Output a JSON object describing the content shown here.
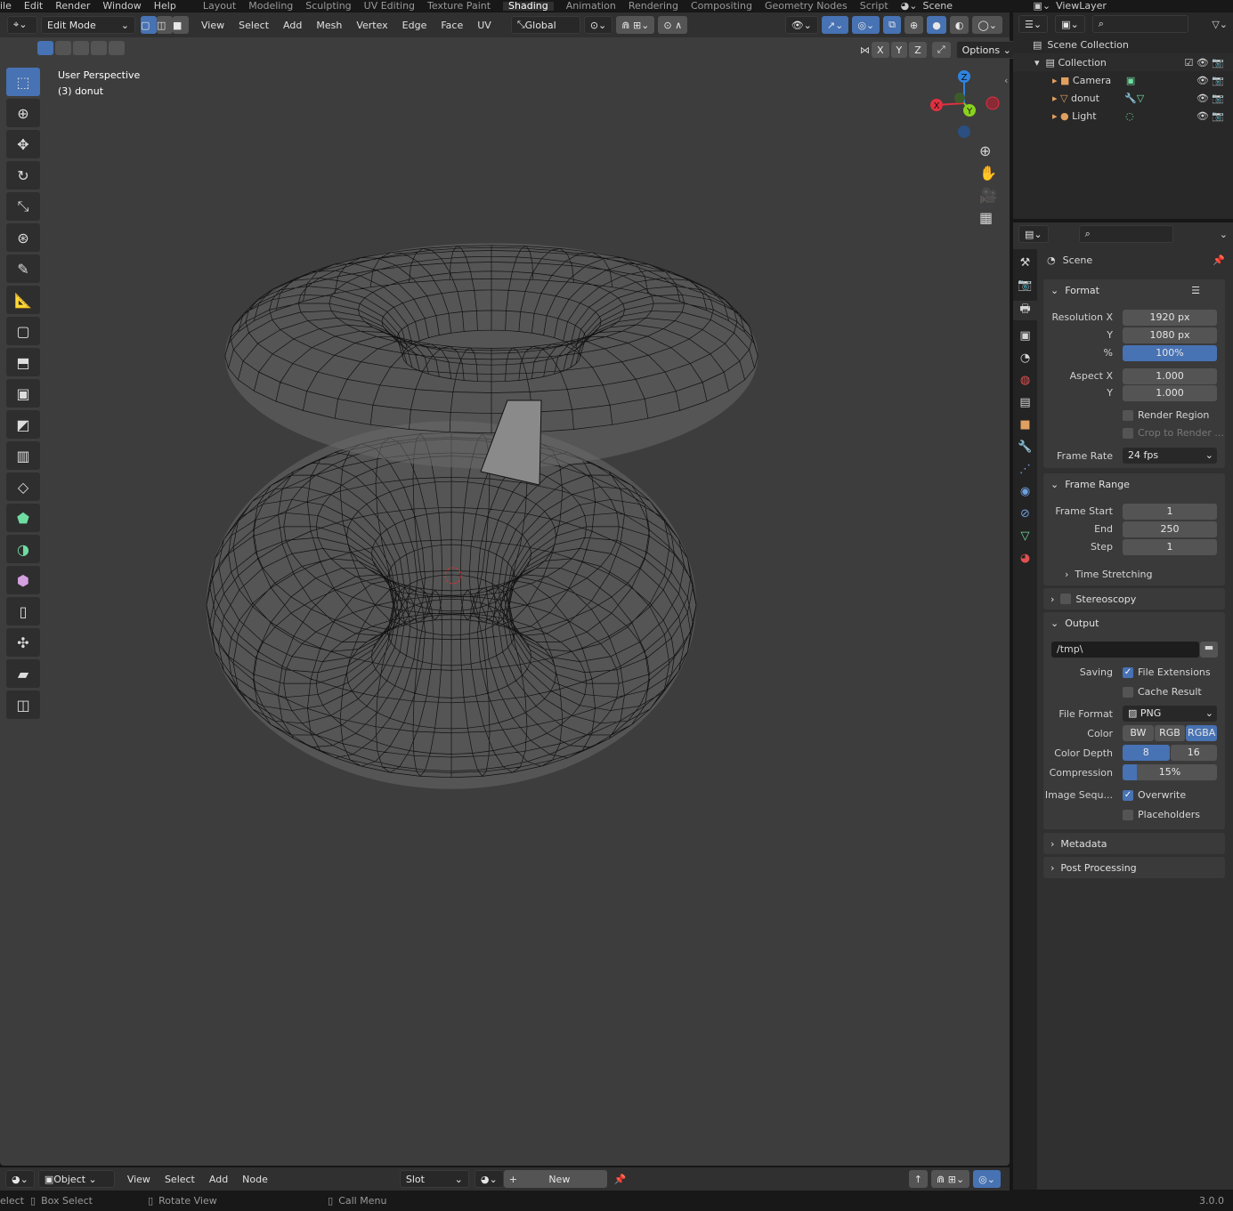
{
  "topbar": {
    "menus": [
      "ile",
      "Edit",
      "Render",
      "Window",
      "Help"
    ],
    "workspaces": [
      "Layout",
      "Modeling",
      "Sculpting",
      "UV Editing",
      "Texture Paint",
      "Shading",
      "Animation",
      "Rendering",
      "Compositing",
      "Geometry Nodes",
      "Script"
    ],
    "active_workspace": "Shading",
    "scene": "Scene",
    "view_layer": "ViewLayer"
  },
  "viewport": {
    "mode": "Edit Mode",
    "menus": [
      "View",
      "Select",
      "Add",
      "Mesh",
      "Vertex",
      "Edge",
      "Face",
      "UV"
    ],
    "orientation": "Global",
    "axes": [
      "X",
      "Y",
      "Z"
    ],
    "options": "Options",
    "overlay_title": "User Perspective",
    "overlay_object": "(3) donut",
    "gizmo": {
      "x": "X",
      "y": "Y",
      "z": "Z"
    }
  },
  "outliner": {
    "root": "Scene Collection",
    "collection": "Collection",
    "items": [
      "Camera",
      "donut",
      "Light"
    ]
  },
  "properties": {
    "context": "Scene",
    "format": {
      "title": "Format",
      "res_x_label": "Resolution X",
      "res_x": "1920 px",
      "res_y_label": "Y",
      "res_y": "1080 px",
      "pct_label": "%",
      "pct": "100%",
      "aspect_x_label": "Aspect X",
      "aspect_x": "1.000",
      "aspect_y_label": "Y",
      "aspect_y": "1.000",
      "render_region": "Render Region",
      "crop": "Crop to Render ...",
      "frame_rate_label": "Frame Rate",
      "frame_rate": "24 fps"
    },
    "frame_range": {
      "title": "Frame Range",
      "start_label": "Frame Start",
      "start": "1",
      "end_label": "End",
      "end": "250",
      "step_label": "Step",
      "step": "1",
      "time_stretching": "Time Stretching"
    },
    "stereoscopy": "Stereoscopy",
    "output": {
      "title": "Output",
      "path": "/tmp\\",
      "saving_label": "Saving",
      "file_ext": "File Extensions",
      "cache": "Cache Result",
      "format_label": "File Format",
      "format": "PNG",
      "color_label": "Color",
      "colors": [
        "BW",
        "RGB",
        "RGBA"
      ],
      "active_color": "RGBA",
      "depth_label": "Color Depth",
      "depths": [
        "8",
        "16"
      ],
      "active_depth": "8",
      "compression_label": "Compression",
      "compression": "15%",
      "compression_value": 15,
      "imgseq_label": "Image Sequ...",
      "overwrite": "Overwrite",
      "placeholders": "Placeholders"
    },
    "metadata": "Metadata",
    "post": "Post Processing"
  },
  "shader_header": {
    "mode": "Object",
    "menus": [
      "View",
      "Select",
      "Add",
      "Node"
    ],
    "slot": "Slot",
    "new": "New"
  },
  "status": {
    "items": [
      "elect",
      "Box Select",
      "Rotate View",
      "Call Menu"
    ],
    "version": "3.0.0"
  },
  "colors": {
    "accent": "#4772b3",
    "viewport": "#3d3d3d"
  }
}
